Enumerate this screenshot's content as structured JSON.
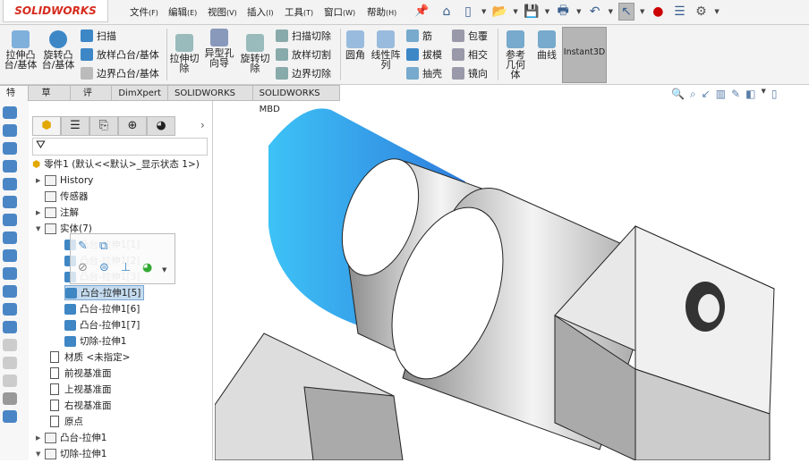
{
  "app": {
    "logo": "SOLIDWORKS"
  },
  "menu": [
    {
      "label": "文件",
      "key": "(F)"
    },
    {
      "label": "编辑",
      "key": "(E)"
    },
    {
      "label": "视图",
      "key": "(V)"
    },
    {
      "label": "插入",
      "key": "(I)"
    },
    {
      "label": "工具",
      "key": "(T)"
    },
    {
      "label": "窗口",
      "key": "(W)"
    },
    {
      "label": "帮助",
      "key": "(H)"
    }
  ],
  "quick_icons": [
    "home-icon",
    "new-document-icon",
    "open-icon",
    "save-icon",
    "print-icon",
    "undo-icon",
    "select-icon",
    "rebuild-icon",
    "file-properties-icon",
    "options-gear-icon"
  ],
  "ribbon": {
    "extrude_boss": "拉伸凸台/基体",
    "revolve_boss": "旋转凸台/基体",
    "sweep": "扫描",
    "loft": "放样凸台/基体",
    "boundary": "边界凸台/基体",
    "extrude_cut": "拉伸切除",
    "hole_wizard": "异型孔向导",
    "revolve_cut": "旋转切除",
    "sweep_cut": "扫描切除",
    "loft_cut": "放样切割",
    "boundary_cut": "边界切除",
    "fillet": "圆角",
    "linear_pattern": "线性阵列",
    "rib": "筋",
    "wrap": "包覆",
    "draft": "拔模",
    "intersect": "相交",
    "shell": "抽壳",
    "mirror": "镜向",
    "ref_geometry": "参考几何体",
    "curves": "曲线",
    "instant3d": "Instant3D"
  },
  "tabs": [
    {
      "label": "特征",
      "active": true
    },
    {
      "label": "草图"
    },
    {
      "label": "评估"
    },
    {
      "label": "DimXpert"
    },
    {
      "label": "SOLIDWORKS 插件"
    },
    {
      "label": "SOLIDWORKS MBD"
    }
  ],
  "tree": {
    "root": "零件1  (默认<<默认>_显示状态 1>)",
    "items": [
      {
        "label": "History",
        "expander": "▶"
      },
      {
        "label": "传感器",
        "expander": ""
      },
      {
        "label": "注解",
        "expander": "▶"
      },
      {
        "label": "实体(7)",
        "expander": "▼"
      },
      {
        "label": "凸台-拉伸1[1]",
        "ghost": true
      },
      {
        "label": "凸台-拉伸1[2]",
        "ghost": true
      },
      {
        "label": "凸台-拉伸1[3]",
        "ghost": true
      },
      {
        "label": "凸台-拉伸1[5]",
        "selected": true
      },
      {
        "label": "凸台-拉伸1[6]"
      },
      {
        "label": "凸台-拉伸1[7]"
      },
      {
        "label": "切除-拉伸1"
      },
      {
        "label": "材质 <未指定>"
      },
      {
        "label": "前视基准面"
      },
      {
        "label": "上视基准面"
      },
      {
        "label": "右视基准面"
      },
      {
        "label": "原点"
      },
      {
        "label": "凸台-拉伸1",
        "expander": "▶"
      },
      {
        "label": "切除-拉伸1",
        "expander": "▼"
      }
    ]
  },
  "colors": {
    "accent": "#d52b1e",
    "selection": "#c5dcf0",
    "transparent_body": "#1fb8f0"
  }
}
